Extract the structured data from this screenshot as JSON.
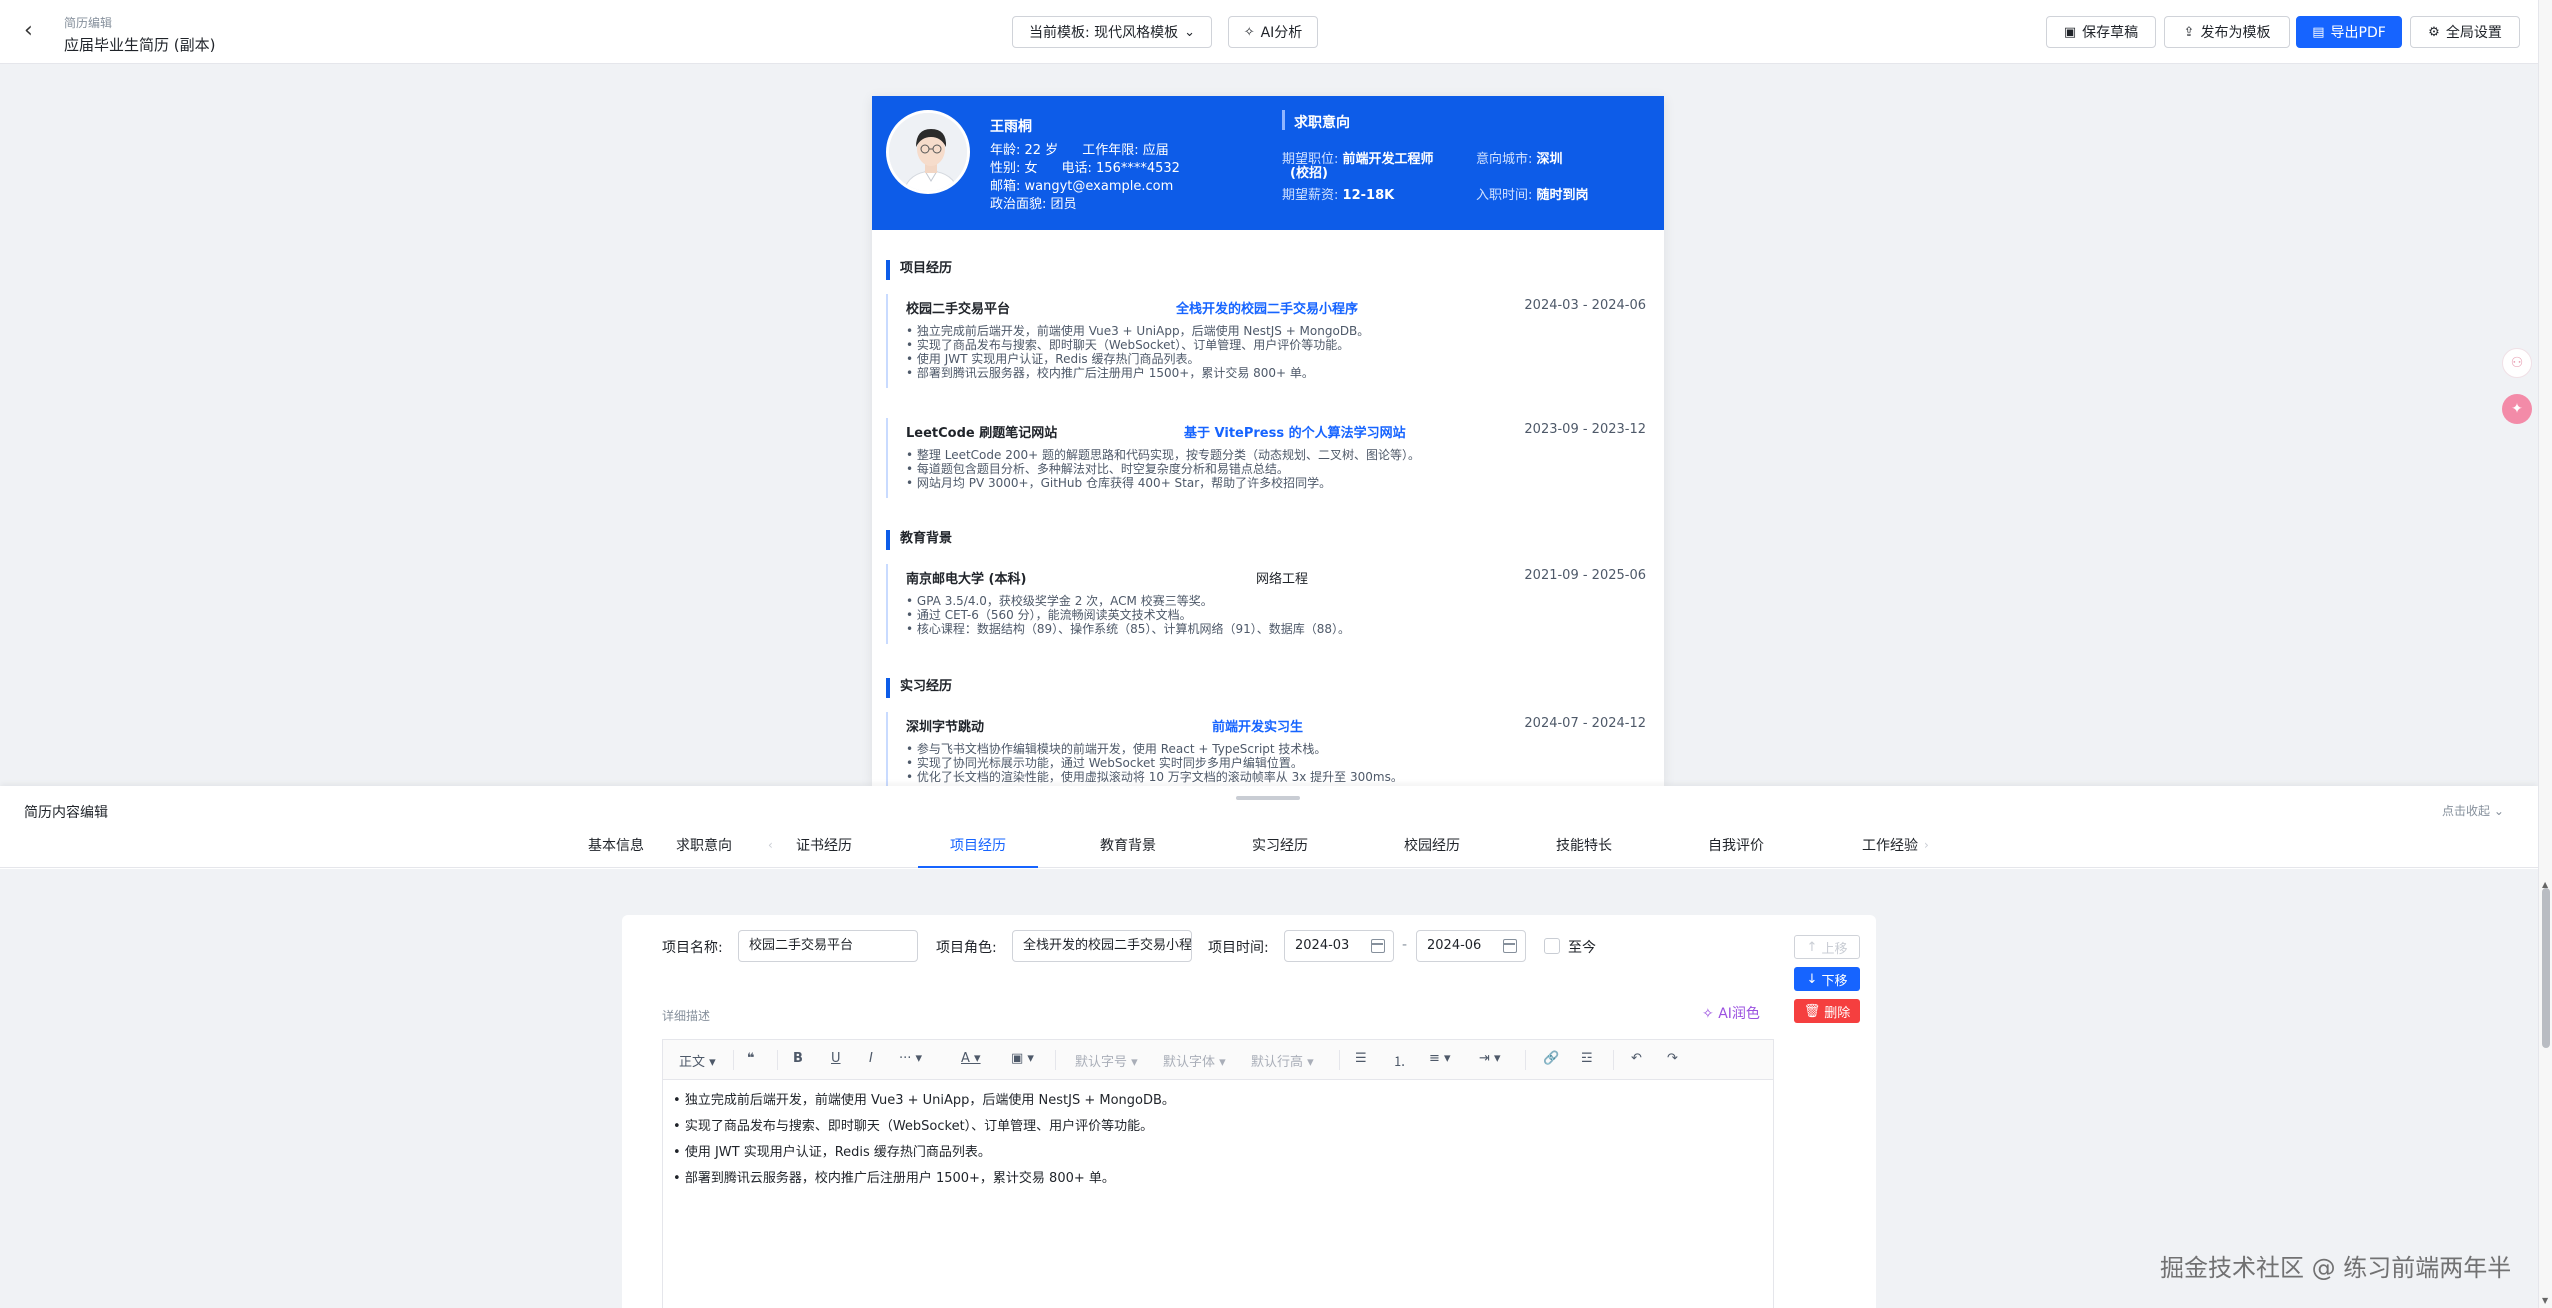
{
  "header": {
    "crumb": "简历编辑",
    "title": "应届毕业生简历 (副本)",
    "template_select": "当前模板: 现代风格模板",
    "ai_analyze": "AI分析",
    "save_draft": "保存草稿",
    "publish_template": "发布为模板",
    "export_pdf": "导出PDF",
    "global_settings": "全局设置"
  },
  "resume": {
    "name": "王雨桐",
    "age": "年龄: 22 岁",
    "work_years": "工作年限: 应届",
    "gender": "性别: 女",
    "phone": "电话: 156****4532",
    "email": "邮箱: wangyt@example.com",
    "politics": "政治面貌: 团员",
    "intent_title": "求职意向",
    "intent": {
      "position_label": "期望职位:",
      "position_value": "前端开发工程师",
      "position_value2": "(校招)",
      "city_label": "意向城市:",
      "city_value": "深圳",
      "salary_label": "期望薪资:",
      "salary_value": "12-18K",
      "start_label": "入职时间:",
      "start_value": "随时到岗"
    },
    "sections": {
      "projects_title": "项目经历",
      "education_title": "教育背景",
      "intern_title": "实习经历"
    },
    "projects": [
      {
        "name": "校园二手交易平台",
        "role": "全栈开发的校园二手交易小程序",
        "time": "2024-03 - 2024-06",
        "bullets": [
          "独立完成前后端开发，前端使用 Vue3 + UniApp，后端使用 NestJS + MongoDB。",
          "实现了商品发布与搜索、即时聊天（WebSocket）、订单管理、用户评价等功能。",
          "使用 JWT 实现用户认证，Redis 缓存热门商品列表。",
          "部署到腾讯云服务器，校内推广后注册用户 1500+，累计交易 800+ 单。"
        ]
      },
      {
        "name": "LeetCode 刷题笔记网站",
        "role": "基于 VitePress 的个人算法学习网站",
        "time": "2023-09 - 2023-12",
        "bullets": [
          "整理 LeetCode 200+ 题的解题思路和代码实现，按专题分类（动态规划、二叉树、图论等）。",
          "每道题包含题目分析、多种解法对比、时空复杂度分析和易错点总结。",
          "网站月均 PV 3000+，GitHub 仓库获得 400+ Star，帮助了许多校招同学。"
        ]
      }
    ],
    "education": [
      {
        "name": "南京邮电大学 (本科)",
        "role": "网络工程",
        "time": "2021-09 - 2025-06",
        "bullets": [
          "GPA 3.5/4.0，获校级奖学金 2 次，ACM 校赛三等奖。",
          "通过 CET-6（560 分），能流畅阅读英文技术文档。",
          "核心课程：数据结构（89）、操作系统（85）、计算机网络（91）、数据库（88）。"
        ]
      }
    ],
    "intern": [
      {
        "name": "深圳字节跳动",
        "role": "前端开发实习生",
        "time": "2024-07 - 2024-12",
        "bullets": [
          "参与飞书文档协作编辑模块的前端开发，使用 React + TypeScript 技术栈。",
          "实现了协同光标展示功能，通过 WebSocket 实时同步多用户编辑位置。",
          "优化了长文档的渲染性能，使用虚拟滚动将 10 万字文档的滚动帧率从 3x 提升至 300ms。"
        ]
      }
    ]
  },
  "panel": {
    "title": "简历内容编辑",
    "collapse": "点击收起",
    "tabs": [
      "基本信息",
      "求职意向",
      "证书经历",
      "项目经历",
      "教育背景",
      "实习经历",
      "校园经历",
      "技能特长",
      "自我评价",
      "工作经验"
    ],
    "form": {
      "name_label": "项目名称:",
      "name_value": "校园二手交易平台",
      "role_label": "项目角色:",
      "role_value": "全栈开发的校园二手交易小程序",
      "time_label": "项目时间:",
      "start": "2024-03",
      "dash": "-",
      "end": "2024-06",
      "present": "至今",
      "detail_label": "详细描述",
      "ai_polish": "AI润色",
      "move_up": "上移",
      "move_down": "下移",
      "delete": "删除"
    },
    "toolbar": {
      "para": "正文",
      "fontsize": "默认字号",
      "fontfamily": "默认字体",
      "lineheight": "默认行高"
    },
    "editor_lines": [
      "独立完成前后端开发，前端使用 Vue3 + UniApp，后端使用 NestJS + MongoDB。",
      "实现了商品发布与搜索、即时聊天（WebSocket）、订单管理、用户评价等功能。",
      "使用 JWT 实现用户认证，Redis 缓存热门商品列表。",
      "部署到腾讯云服务器，校内推广后注册用户 1500+，累计交易 800+ 单。"
    ]
  },
  "watermark": "掘金技术社区 @ 练习前端两年半",
  "colors": {
    "brand": "#1664ff",
    "resume_header": "#0d5ce8",
    "danger": "#f53f3f",
    "ai": "#9b51e0"
  }
}
